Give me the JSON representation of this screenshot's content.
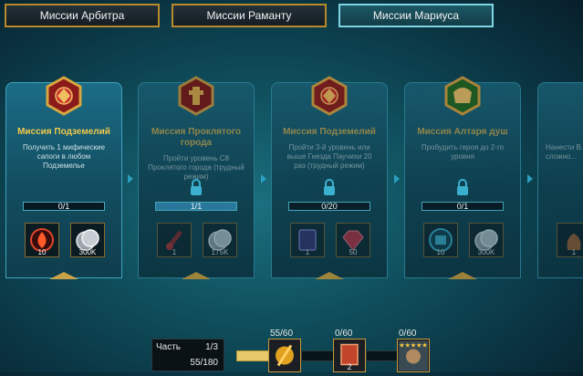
{
  "tabs": [
    {
      "label": "Миссии Арбитра"
    },
    {
      "label": "Миссии Раманту"
    },
    {
      "label": "Миссии Мариуса"
    }
  ],
  "missions": [
    {
      "title": "Миссия Подземелий",
      "desc": "Получить 1 мифические сапоги в любом Подземелье",
      "progress": "0/1",
      "progress_fraction": 0,
      "locked": false,
      "rewards": [
        {
          "icon": "red-fire-shard-icon",
          "qty": "10"
        },
        {
          "icon": "silver-coins-icon",
          "qty": "300K"
        }
      ]
    },
    {
      "title": "Миссия Проклятого города",
      "desc": "Пройти уровень С8 Проклятого города (трудный режим)",
      "progress": "1/1",
      "progress_fraction": 1,
      "locked": true,
      "rewards": [
        {
          "icon": "red-potion-icon",
          "qty": "1"
        },
        {
          "icon": "silver-coins-icon",
          "qty": "175K"
        }
      ]
    },
    {
      "title": "Миссия Подземелий",
      "desc": "Пройти 3-й уровень или выше Гнезда Паучихи 20 раз (трудный режим)",
      "progress": "0/20",
      "progress_fraction": 0,
      "locked": true,
      "rewards": [
        {
          "icon": "purple-tome-icon",
          "qty": "1"
        },
        {
          "icon": "ruby-gem-icon",
          "qty": "50"
        }
      ]
    },
    {
      "title": "Миссия Алтаря душ",
      "desc": "Пробудить героя до 2-го уровня",
      "progress": "0/1",
      "progress_fraction": 0,
      "locked": true,
      "rewards": [
        {
          "icon": "blue-chest-icon",
          "qty": "10"
        },
        {
          "icon": "silver-coins-icon",
          "qty": "300K"
        }
      ]
    },
    {
      "title": "",
      "desc": "Нанести В... одну... сложно...",
      "progress": "",
      "locked": true,
      "rewards": [
        {
          "icon": "orange-bag-icon",
          "qty": "1"
        }
      ]
    }
  ],
  "footer": {
    "part_label": "Часть",
    "part_value": "1/3",
    "part_progress": "55/180",
    "milestones": [
      {
        "label": "55/60",
        "qty": "",
        "icon": "golden-artifact-icon"
      },
      {
        "label": "0/60",
        "qty": "2",
        "icon": "orange-tome-icon"
      },
      {
        "label": "0/60",
        "qty": "",
        "icon": "champion-portrait-icon"
      }
    ]
  },
  "colors": {
    "accent_gold": "#f2c94c",
    "tab_border": "#b88a2b",
    "active_tab_border": "#7fd4e4"
  }
}
